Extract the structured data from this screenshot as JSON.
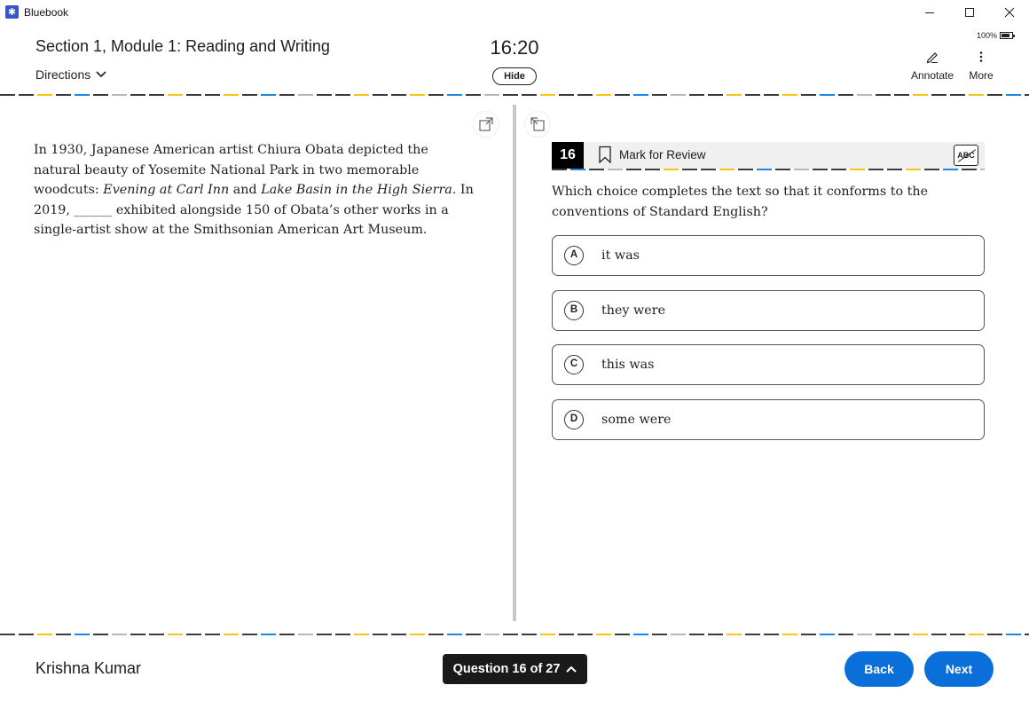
{
  "titlebar": {
    "app_name": "Bluebook",
    "logo_glyph": "✱"
  },
  "header": {
    "section_title": "Section 1, Module 1: Reading and Writing",
    "directions_label": "Directions",
    "timer": "16:20",
    "hide_label": "Hide",
    "battery": "100%",
    "annotate_label": "Annotate",
    "more_label": "More"
  },
  "passage": {
    "segments": [
      {
        "text": "In 1930, Japanese American artist Chiura Obata depicted the natural beauty of Yosemite National Park in two memorable woodcuts: ",
        "italic": false
      },
      {
        "text": "Evening at Carl Inn",
        "italic": true
      },
      {
        "text": " and ",
        "italic": false
      },
      {
        "text": "Lake Basin in the High Sierra.",
        "italic": true
      },
      {
        "text": " In 2019, ______ exhibited alongside 150 of Obata’s other works in a single-artist show at the Smithsonian American Art Museum.",
        "italic": false
      }
    ]
  },
  "question": {
    "number": "16",
    "mark_for_review_label": "Mark for Review",
    "abc_label": "ABC",
    "prompt": "Which choice completes the text so that it conforms to the conventions of Standard English?",
    "choices": [
      {
        "letter": "A",
        "text": "it was"
      },
      {
        "letter": "B",
        "text": "they were"
      },
      {
        "letter": "C",
        "text": "this was"
      },
      {
        "letter": "D",
        "text": "some were"
      }
    ]
  },
  "footer": {
    "student_name": "Krishna Kumar",
    "question_nav_label": "Question 16 of 27",
    "back_label": "Back",
    "next_label": "Next"
  },
  "colors": {
    "accent_blue": "#0b6fd9",
    "dash_dark": "#3c3c3c",
    "dash_yellow": "#f5c518",
    "dash_blue": "#1e88e5",
    "dash_gray": "#b9b9b9"
  }
}
